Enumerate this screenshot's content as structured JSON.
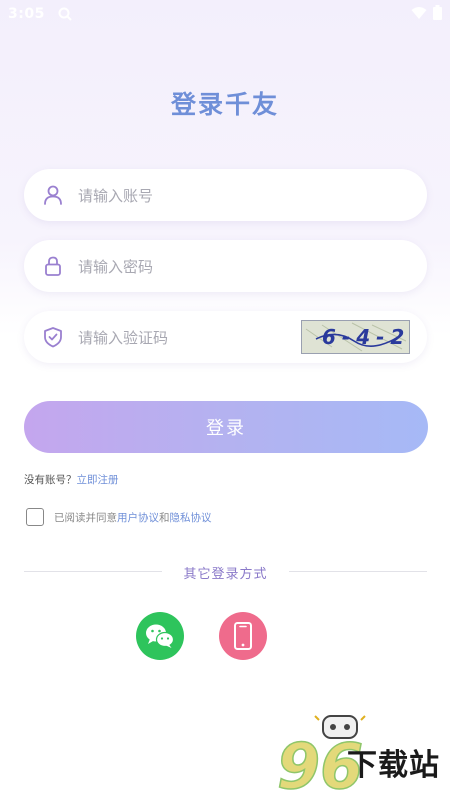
{
  "status_bar": {
    "time": "3:05",
    "left_icon": "notification-icon",
    "right_icons": [
      "wifi-icon",
      "battery-icon"
    ]
  },
  "header": {
    "title": "登录千友"
  },
  "form": {
    "account": {
      "placeholder": "请输入账号",
      "value": "",
      "icon": "user-icon"
    },
    "password": {
      "placeholder": "请输入密码",
      "value": "",
      "icon": "lock-icon"
    },
    "captcha": {
      "placeholder": "请输入验证码",
      "value": "",
      "icon": "shield-icon",
      "image_text": "6-4-2"
    },
    "login_button": "登录"
  },
  "register": {
    "prompt": "没有账号？",
    "link": "立即注册"
  },
  "agreement": {
    "checked": false,
    "prefix": "已阅读并同意",
    "user_agreement": "用户协议",
    "and": "和",
    "privacy_policy": "隐私协议"
  },
  "other_login": {
    "label": "其它登录方式",
    "options": [
      {
        "name": "wechat",
        "icon": "wechat-icon",
        "color": "#2ec45c"
      },
      {
        "name": "phone",
        "icon": "phone-icon",
        "color": "#ef6b8c"
      }
    ]
  },
  "colors": {
    "accent": "#6f8fd8",
    "divider_text": "#8a79c9",
    "button_gradient_start": "#c4a6ee",
    "button_gradient_end": "#a6b9f6"
  },
  "watermark": {
    "number": "96",
    "text": "下载站"
  }
}
